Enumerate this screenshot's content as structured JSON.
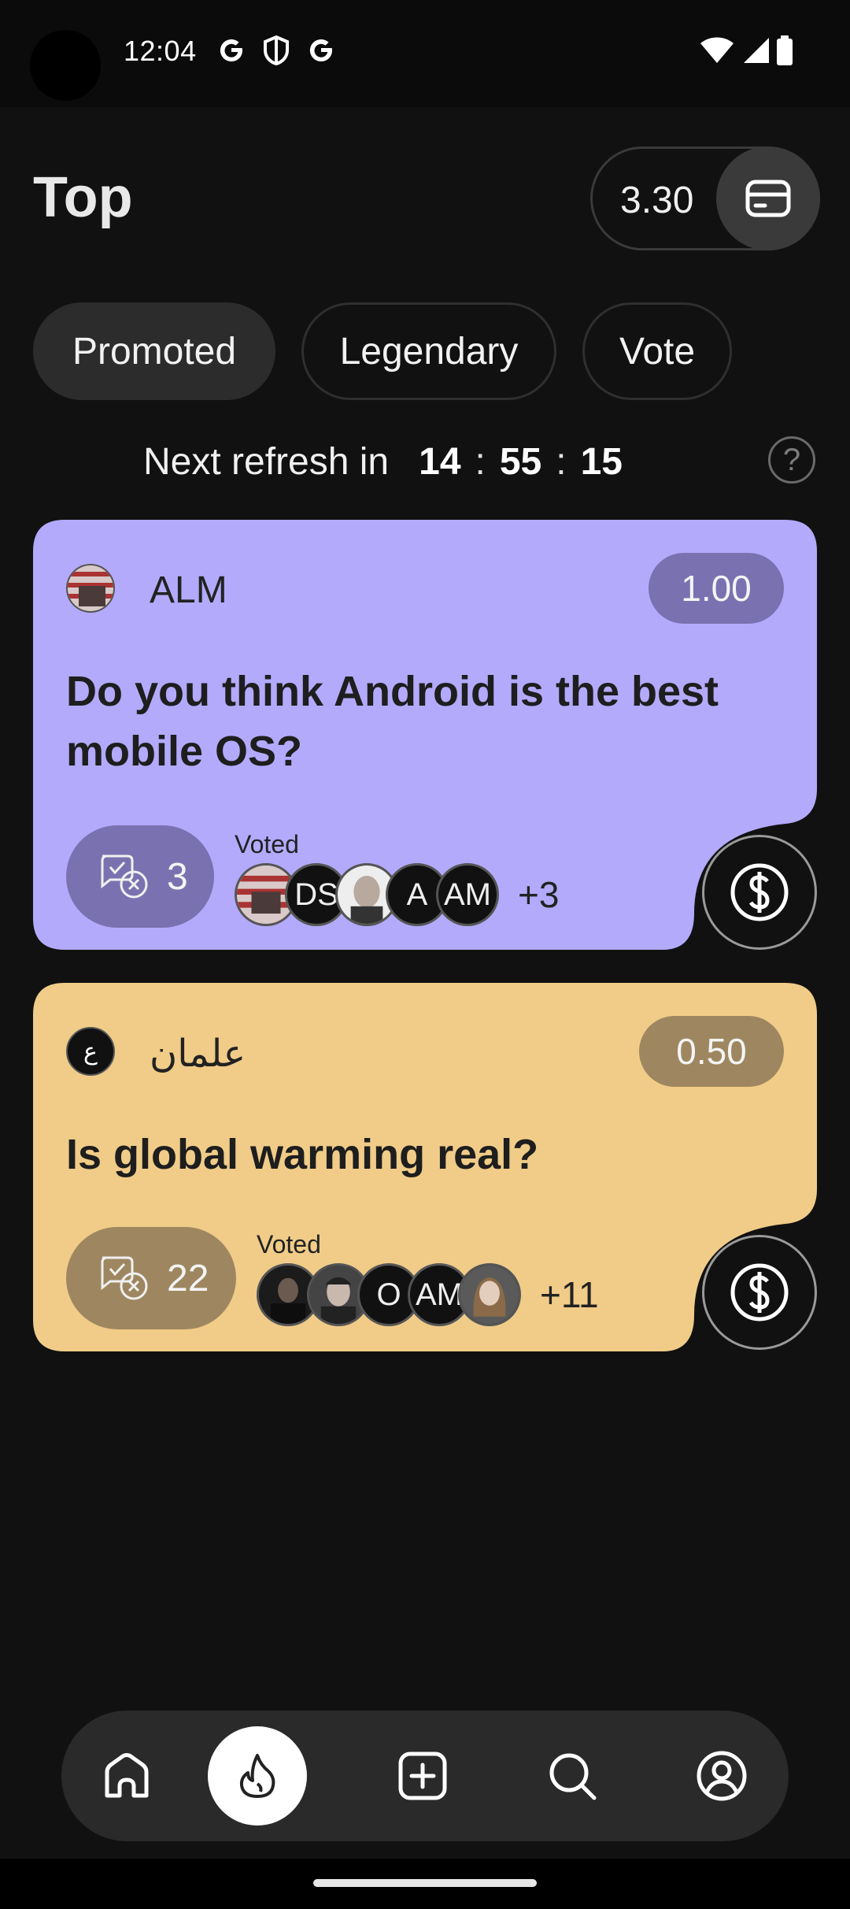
{
  "status_bar": {
    "time": "12:04",
    "icons": [
      "google-g-icon",
      "shield-icon",
      "google-g-icon",
      "wifi-icon",
      "signal-icon",
      "battery-icon"
    ]
  },
  "header": {
    "title": "Top",
    "balance": "3.30",
    "wallet_icon": "wallet-card-icon"
  },
  "tabs": [
    {
      "label": "Promoted",
      "active": true
    },
    {
      "label": "Legendary",
      "active": false
    },
    {
      "label": "Vote",
      "active": false
    }
  ],
  "refresh": {
    "label": "Next refresh in",
    "hours": "14",
    "minutes": "55",
    "seconds": "15",
    "separator": ":",
    "help": "?"
  },
  "colors": {
    "card1_bg": "#b3aafc",
    "card1_accent": "#7a72b0",
    "card2_bg": "#f0cc88",
    "card2_accent": "#9e8760",
    "background": "#111111"
  },
  "cards": [
    {
      "author": "ALM",
      "reward": "1.00",
      "question": "Do you think Android is the best mobile OS?",
      "comments": "3",
      "voted_label": "Voted",
      "voters": [
        "",
        "DS",
        "",
        "A",
        "AM"
      ],
      "voters_more": "+3"
    },
    {
      "author_initial": "ع",
      "author": "علمان",
      "reward": "0.50",
      "question": "Is global warming real?",
      "comments": "22",
      "voted_label": "Voted",
      "voters": [
        "",
        "",
        "O",
        "AM",
        ""
      ],
      "voters_more": "+11"
    }
  ],
  "bottom_nav": [
    "home-icon",
    "flame-icon",
    "add-square-icon",
    "search-icon",
    "profile-icon"
  ]
}
